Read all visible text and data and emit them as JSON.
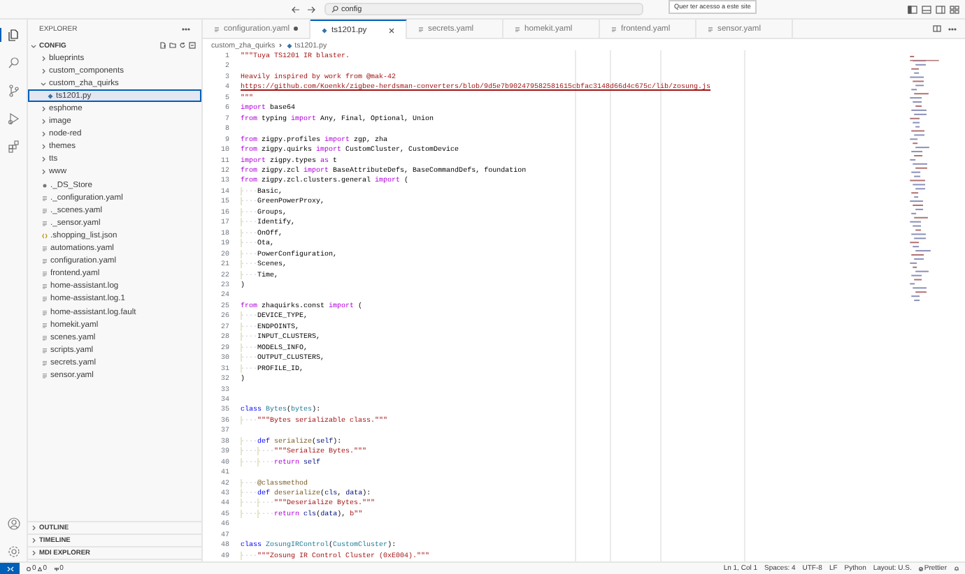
{
  "title_bar": {
    "search": "config",
    "tooltip": "Quer ter acesso a este site"
  },
  "activity_bar": [
    {
      "kind": "files",
      "selected": true
    },
    {
      "kind": "search",
      "selected": false
    },
    {
      "kind": "source-control",
      "selected": false
    },
    {
      "kind": "run",
      "selected": false
    },
    {
      "kind": "extensions",
      "selected": false
    }
  ],
  "sidebar": {
    "title": "EXPLORER",
    "folder": {
      "name": "CONFIG",
      "expanded": true
    },
    "tree": [
      {
        "name": "blueprints",
        "kind": "folder",
        "expanded": false,
        "selected": false
      },
      {
        "name": "custom_components",
        "kind": "folder",
        "expanded": false,
        "selected": false
      },
      {
        "name": "custom_zha_quirks",
        "kind": "folder",
        "expanded": true,
        "selected": false,
        "children": [
          {
            "name": "ts1201.py",
            "kind": "python",
            "selected": true
          }
        ]
      },
      {
        "name": "esphome",
        "kind": "folder",
        "expanded": false,
        "selected": false
      },
      {
        "name": "image",
        "kind": "folder",
        "expanded": false,
        "selected": false
      },
      {
        "name": "node-red",
        "kind": "folder",
        "expanded": false,
        "selected": false
      },
      {
        "name": "themes",
        "kind": "folder",
        "expanded": false,
        "selected": false
      },
      {
        "name": "tts",
        "kind": "folder",
        "expanded": false,
        "selected": false
      },
      {
        "name": "www",
        "kind": "folder",
        "expanded": false,
        "selected": false
      },
      {
        "name": "._DS_Store",
        "kind": "settings",
        "selected": false
      },
      {
        "name": "._configuration.yaml",
        "kind": "file",
        "selected": false
      },
      {
        "name": "._scenes.yaml",
        "kind": "file",
        "selected": false
      },
      {
        "name": "._sensor.yaml",
        "kind": "file",
        "selected": false
      },
      {
        "name": ".shopping_list.json",
        "kind": "json",
        "selected": false
      },
      {
        "name": "automations.yaml",
        "kind": "file",
        "selected": false
      },
      {
        "name": "configuration.yaml",
        "kind": "file",
        "selected": false
      },
      {
        "name": "frontend.yaml",
        "kind": "file",
        "selected": false
      },
      {
        "name": "home-assistant.log",
        "kind": "file",
        "selected": false
      },
      {
        "name": "home-assistant.log.1",
        "kind": "file",
        "selected": false
      },
      {
        "name": "home-assistant.log.fault",
        "kind": "file",
        "selected": false
      },
      {
        "name": "homekit.yaml",
        "kind": "file",
        "selected": false
      },
      {
        "name": "scenes.yaml",
        "kind": "file",
        "selected": false
      },
      {
        "name": "scripts.yaml",
        "kind": "file",
        "selected": false
      },
      {
        "name": "secrets.yaml",
        "kind": "file",
        "selected": false
      },
      {
        "name": "sensor.yaml",
        "kind": "file",
        "selected": false
      }
    ],
    "panels": [
      {
        "label": "OUTLINE",
        "expanded": false
      },
      {
        "label": "TIMELINE",
        "expanded": false
      },
      {
        "label": "MDI EXPLORER",
        "expanded": false
      }
    ]
  },
  "tabs": [
    {
      "label": "configuration.yaml",
      "kind": "file",
      "modified": true,
      "selected": false
    },
    {
      "label": "ts1201.py",
      "kind": "python",
      "modified": false,
      "selected": true
    },
    {
      "label": "secrets.yaml",
      "kind": "file",
      "modified": false,
      "selected": false
    },
    {
      "label": "homekit.yaml",
      "kind": "file",
      "modified": false,
      "selected": false
    },
    {
      "label": "frontend.yaml",
      "kind": "file",
      "modified": false,
      "selected": false
    },
    {
      "label": "sensor.yaml",
      "kind": "file",
      "modified": false,
      "selected": false
    }
  ],
  "breadcrumb": [
    {
      "label": "custom_zha_quirks",
      "kind": "folder"
    },
    {
      "label": "ts1201.py",
      "kind": "python"
    }
  ],
  "code": [
    {
      "n": "1",
      "tokens": [
        {
          "kind": "str",
          "text": "\"\"\"Tuya TS1201 IR blaster."
        }
      ]
    },
    {
      "n": "2"
    },
    {
      "n": "3",
      "tokens": [
        {
          "kind": "str",
          "text": "Heavily inspired by work from @mak-42"
        }
      ]
    },
    {
      "n": "4",
      "tokens": [
        {
          "kind": "link",
          "text": "https://github.com/Koenkk/zigbee-herdsman-converters/blob/9d5e7b902479582581615cbfac3148d66d4c675c/lib/zosung.js"
        }
      ]
    },
    {
      "n": "5",
      "tokens": [
        {
          "kind": "str",
          "text": "\"\"\""
        }
      ]
    },
    {
      "n": "6",
      "tokens": [
        {
          "kind": "ctrl",
          "text": "import"
        },
        {
          "kind": "text",
          "text": " base64"
        }
      ]
    },
    {
      "n": "7",
      "tokens": [
        {
          "kind": "ctrl",
          "text": "from"
        },
        {
          "kind": "text",
          "text": " typing "
        },
        {
          "kind": "ctrl",
          "text": "import"
        },
        {
          "kind": "text",
          "text": " Any, Final, Optional, Union"
        }
      ]
    },
    {
      "n": "8"
    },
    {
      "n": "9",
      "tokens": [
        {
          "kind": "ctrl",
          "text": "from"
        },
        {
          "kind": "text",
          "text": " zigpy.profiles "
        },
        {
          "kind": "ctrl",
          "text": "import"
        },
        {
          "kind": "text",
          "text": " zgp, zha"
        }
      ]
    },
    {
      "n": "10",
      "tokens": [
        {
          "kind": "ctrl",
          "text": "from"
        },
        {
          "kind": "text",
          "text": " zigpy.quirks "
        },
        {
          "kind": "ctrl",
          "text": "import"
        },
        {
          "kind": "text",
          "text": " CustomCluster, CustomDevice"
        }
      ]
    },
    {
      "n": "11",
      "tokens": [
        {
          "kind": "ctrl",
          "text": "import"
        },
        {
          "kind": "text",
          "text": " zigpy.types "
        },
        {
          "kind": "ctrl",
          "text": "as"
        },
        {
          "kind": "text",
          "text": " t"
        }
      ]
    },
    {
      "n": "12",
      "tokens": [
        {
          "kind": "ctrl",
          "text": "from"
        },
        {
          "kind": "text",
          "text": " zigpy.zcl "
        },
        {
          "kind": "ctrl",
          "text": "import"
        },
        {
          "kind": "text",
          "text": " BaseAttributeDefs, BaseCommandDefs, foundation"
        }
      ]
    },
    {
      "n": "13",
      "tokens": [
        {
          "kind": "ctrl",
          "text": "from"
        },
        {
          "kind": "text",
          "text": " zigpy.zcl.clusters.general "
        },
        {
          "kind": "ctrl",
          "text": "import"
        },
        {
          "kind": "text",
          "text": " ("
        }
      ]
    },
    {
      "n": "14",
      "tokens": [
        {
          "kind": "ws",
          "text": "····"
        },
        {
          "kind": "text",
          "text": "Basic,"
        }
      ]
    },
    {
      "n": "15",
      "tokens": [
        {
          "kind": "ws",
          "text": "····"
        },
        {
          "kind": "text",
          "text": "GreenPowerProxy,"
        }
      ]
    },
    {
      "n": "16",
      "tokens": [
        {
          "kind": "ws",
          "text": "····"
        },
        {
          "kind": "text",
          "text": "Groups,"
        }
      ]
    },
    {
      "n": "17",
      "tokens": [
        {
          "kind": "ws",
          "text": "····"
        },
        {
          "kind": "text",
          "text": "Identify,"
        }
      ]
    },
    {
      "n": "18",
      "tokens": [
        {
          "kind": "ws",
          "text": "····"
        },
        {
          "kind": "text",
          "text": "OnOff,"
        }
      ]
    },
    {
      "n": "19",
      "tokens": [
        {
          "kind": "ws",
          "text": "····"
        },
        {
          "kind": "text",
          "text": "Ota,"
        }
      ]
    },
    {
      "n": "20",
      "tokens": [
        {
          "kind": "ws",
          "text": "····"
        },
        {
          "kind": "text",
          "text": "PowerConfiguration,"
        }
      ]
    },
    {
      "n": "21",
      "tokens": [
        {
          "kind": "ws",
          "text": "····"
        },
        {
          "kind": "text",
          "text": "Scenes,"
        }
      ]
    },
    {
      "n": "22",
      "tokens": [
        {
          "kind": "ws",
          "text": "····"
        },
        {
          "kind": "text",
          "text": "Time,"
        }
      ]
    },
    {
      "n": "23",
      "tokens": [
        {
          "kind": "text",
          "text": ")"
        }
      ]
    },
    {
      "n": "24"
    },
    {
      "n": "25",
      "tokens": [
        {
          "kind": "ctrl",
          "text": "from"
        },
        {
          "kind": "text",
          "text": " zhaquirks.const "
        },
        {
          "kind": "ctrl",
          "text": "import"
        },
        {
          "kind": "text",
          "text": " ("
        }
      ]
    },
    {
      "n": "26",
      "tokens": [
        {
          "kind": "ws",
          "text": "····"
        },
        {
          "kind": "text",
          "text": "DEVICE_TYPE,"
        }
      ]
    },
    {
      "n": "27",
      "tokens": [
        {
          "kind": "ws",
          "text": "····"
        },
        {
          "kind": "text",
          "text": "ENDPOINTS,"
        }
      ]
    },
    {
      "n": "28",
      "tokens": [
        {
          "kind": "ws",
          "text": "····"
        },
        {
          "kind": "text",
          "text": "INPUT_CLUSTERS,"
        }
      ]
    },
    {
      "n": "29",
      "tokens": [
        {
          "kind": "ws",
          "text": "····"
        },
        {
          "kind": "text",
          "text": "MODELS_INFO,"
        }
      ]
    },
    {
      "n": "30",
      "tokens": [
        {
          "kind": "ws",
          "text": "····"
        },
        {
          "kind": "text",
          "text": "OUTPUT_CLUSTERS,"
        }
      ]
    },
    {
      "n": "31",
      "tokens": [
        {
          "kind": "ws",
          "text": "····"
        },
        {
          "kind": "text",
          "text": "PROFILE_ID,"
        }
      ]
    },
    {
      "n": "32",
      "tokens": [
        {
          "kind": "text",
          "text": ")"
        }
      ]
    },
    {
      "n": "33"
    },
    {
      "n": "34"
    },
    {
      "n": "35",
      "tokens": [
        {
          "kind": "kw",
          "text": "class "
        },
        {
          "kind": "cls",
          "text": "Bytes"
        },
        {
          "kind": "text",
          "text": "("
        },
        {
          "kind": "cls",
          "text": "bytes"
        },
        {
          "kind": "text",
          "text": "):"
        }
      ]
    },
    {
      "n": "36",
      "tokens": [
        {
          "kind": "ws",
          "text": "····"
        },
        {
          "kind": "str",
          "text": "\"\"\"Bytes serializable class.\"\"\""
        }
      ]
    },
    {
      "n": "37"
    },
    {
      "n": "38",
      "tokens": [
        {
          "kind": "ws",
          "text": "····"
        },
        {
          "kind": "kw",
          "text": "def "
        },
        {
          "kind": "fn",
          "text": "serialize"
        },
        {
          "kind": "text",
          "text": "("
        },
        {
          "kind": "param",
          "text": "self"
        },
        {
          "kind": "text",
          "text": "):"
        }
      ]
    },
    {
      "n": "39",
      "tokens": [
        {
          "kind": "ws",
          "text": "····"
        },
        {
          "kind": "ws",
          "text": "····"
        },
        {
          "kind": "str",
          "text": "\"\"\"Serialize Bytes.\"\"\""
        }
      ]
    },
    {
      "n": "40",
      "tokens": [
        {
          "kind": "ws",
          "text": "····"
        },
        {
          "kind": "ws",
          "text": "····"
        },
        {
          "kind": "ctrl",
          "text": "return "
        },
        {
          "kind": "param",
          "text": "self"
        }
      ]
    },
    {
      "n": "41"
    },
    {
      "n": "42",
      "tokens": [
        {
          "kind": "ws",
          "text": "····"
        },
        {
          "kind": "deco",
          "text": "@classmethod"
        }
      ]
    },
    {
      "n": "43",
      "tokens": [
        {
          "kind": "ws",
          "text": "····"
        },
        {
          "kind": "kw",
          "text": "def "
        },
        {
          "kind": "fn",
          "text": "deserialize"
        },
        {
          "kind": "text",
          "text": "("
        },
        {
          "kind": "param",
          "text": "cls"
        },
        {
          "kind": "text",
          "text": ", "
        },
        {
          "kind": "param",
          "text": "data"
        },
        {
          "kind": "text",
          "text": "):"
        }
      ]
    },
    {
      "n": "44",
      "tokens": [
        {
          "kind": "ws",
          "text": "····"
        },
        {
          "kind": "ws",
          "text": "····"
        },
        {
          "kind": "str",
          "text": "\"\"\"Deserialize Bytes.\"\"\""
        }
      ]
    },
    {
      "n": "45",
      "tokens": [
        {
          "kind": "ws",
          "text": "····"
        },
        {
          "kind": "ws",
          "text": "····"
        },
        {
          "kind": "ctrl",
          "text": "return "
        },
        {
          "kind": "param",
          "text": "cls"
        },
        {
          "kind": "text",
          "text": "("
        },
        {
          "kind": "param",
          "text": "data"
        },
        {
          "kind": "text",
          "text": "), "
        },
        {
          "kind": "str",
          "text": "b\"\""
        }
      ]
    },
    {
      "n": "46"
    },
    {
      "n": "47"
    },
    {
      "n": "48",
      "tokens": [
        {
          "kind": "kw",
          "text": "class "
        },
        {
          "kind": "cls",
          "text": "ZosungIRControl"
        },
        {
          "kind": "text",
          "text": "("
        },
        {
          "kind": "cls",
          "text": "CustomCluster"
        },
        {
          "kind": "text",
          "text": "):"
        }
      ]
    },
    {
      "n": "49",
      "tokens": [
        {
          "kind": "ws",
          "text": "····"
        },
        {
          "kind": "str",
          "text": "\"\"\"Zosung IR Control Cluster (0xE004).\"\"\""
        }
      ]
    }
  ],
  "status_bar": {
    "errors": "0",
    "warnings": "0",
    "ports": "0",
    "items": [
      "Ln 1, Col 1",
      "Spaces: 4",
      "UTF-8",
      "LF",
      "Python",
      "Layout: U.S."
    ],
    "prettier": "Prettier"
  }
}
